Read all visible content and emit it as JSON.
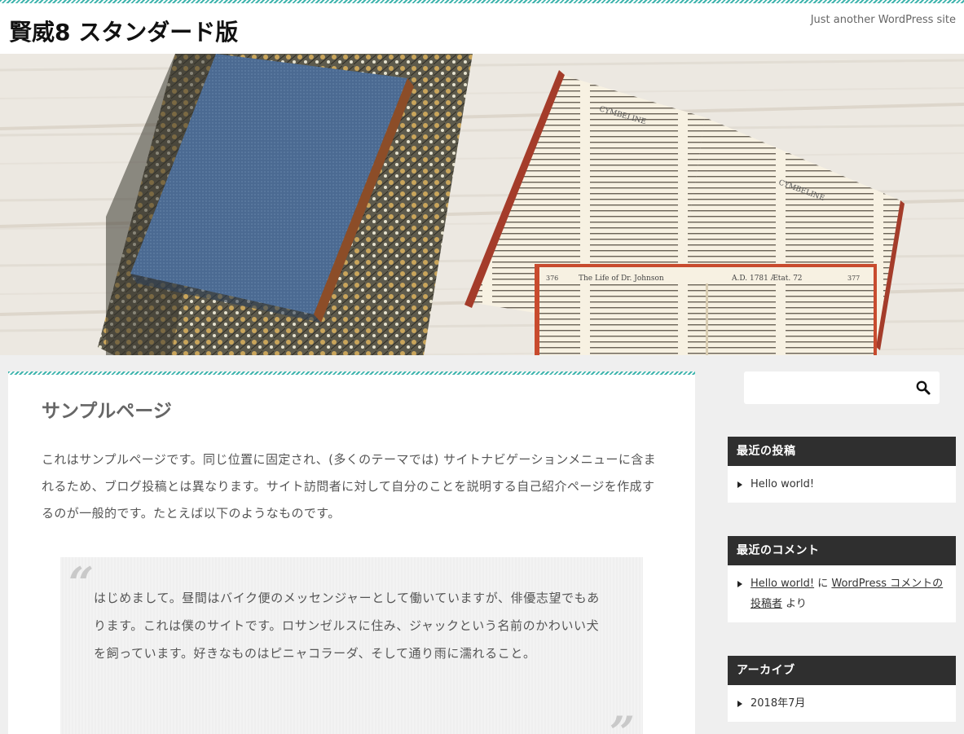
{
  "site": {
    "title": "賢威8 スタンダード版",
    "tagline": "Just another WordPress site"
  },
  "hero": {
    "left_book_header": "The Life of Dr. Johnson",
    "right_book_header": "A.D. 1781 Ætat. 72",
    "left_page_number": "376",
    "right_page_number": "377",
    "top_book_header_left": "CYMBELINE",
    "top_book_header_right": "CYMBELINE"
  },
  "main": {
    "page_title": "サンプルページ",
    "intro": "これはサンプルページです。同じ位置に固定され、(多くのテーマでは) サイトナビゲーションメニューに含まれるため、ブログ投稿とは異なります。サイト訪問者に対して自分のことを説明する自己紹介ページを作成するのが一般的です。たとえば以下のようなものです。",
    "quote_open": "“",
    "quote_close": "”",
    "quote": "はじめまして。昼間はバイク便のメッセンジャーとして働いていますが、俳優志望でもあります。これは僕のサイトです。ロサンゼルスに住み、ジャックという名前のかわいい犬を飼っています。好きなものはピニャコラーダ、そして通り雨に濡れること。"
  },
  "sidebar": {
    "search": {
      "value": "",
      "icon": "search-icon"
    },
    "recent_posts": {
      "title": "最近の投稿",
      "items": [
        "Hello world!"
      ]
    },
    "recent_comments": {
      "title": "最近のコメント",
      "post_link": "Hello world!",
      "on": "に",
      "author_link": "WordPress コメントの投稿者",
      "by": "より"
    },
    "archives": {
      "title": "アーカイブ",
      "items": [
        "2018年7月"
      ]
    }
  },
  "colors": {
    "accent": "#3fb4ad",
    "widget_title_bg": "#2f2f2f",
    "page_bg": "#efefef"
  }
}
